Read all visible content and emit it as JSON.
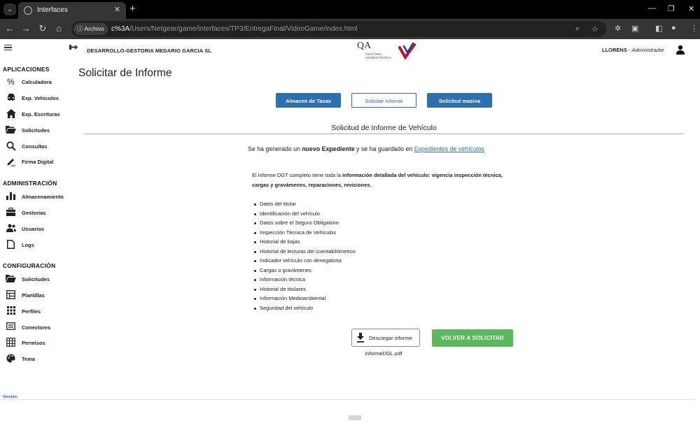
{
  "browser": {
    "tab_title": "Interfaces",
    "site_chip": "Archivo",
    "url_highlight": "c%3A",
    "url_rest": "/Users/Netgear/game/interfaces/TP3/EntregaFinal/VideoGame/index.html"
  },
  "header": {
    "company": "DESARROLLO-GESTORIA MEDARIO GARCIA SL",
    "logo_mark": "QA",
    "logo_text": "GESTORIA ADMINISTRATIVA",
    "user": "LLORENS",
    "role": "Administrador"
  },
  "sidebar": {
    "sections": {
      "aplicaciones": "APLICACIONES",
      "administracion": "ADMINISTRACIÓN",
      "configuracion": "CONFIGURACIÓN"
    },
    "aplicaciones": [
      {
        "label": "Calculadora",
        "icon": "percent-icon"
      },
      {
        "label": "Exp. Vehiculos",
        "icon": "car-icon"
      },
      {
        "label": "Exp. Escrituras",
        "icon": "home-icon"
      },
      {
        "label": "Solicitudes",
        "icon": "folder-open-icon"
      },
      {
        "label": "Consultas",
        "icon": "search-icon"
      },
      {
        "label": "Firma Digital",
        "icon": "signature-icon"
      }
    ],
    "administracion": [
      {
        "label": "Almacenamiento",
        "icon": "bar-chart-icon"
      },
      {
        "label": "Gestorias",
        "icon": "briefcase-icon"
      },
      {
        "label": "Usuarios",
        "icon": "users-icon"
      },
      {
        "label": "Logs",
        "icon": "document-icon"
      }
    ],
    "configuracion": [
      {
        "label": "Solicitudes",
        "icon": "folder-open-icon"
      },
      {
        "label": "Plantillas",
        "icon": "template-icon"
      },
      {
        "label": "Perfiles",
        "icon": "grid-icon"
      },
      {
        "label": "Conectores",
        "icon": "connector-icon"
      },
      {
        "label": "Permisos",
        "icon": "table-icon"
      },
      {
        "label": "Tema",
        "icon": "palette-icon"
      }
    ],
    "version_label": "Versión:"
  },
  "main": {
    "title": "Solicitar de Informe",
    "buttons": {
      "almacen": "Almacen de Tasas",
      "solicitar": "Solicitar Informe",
      "masiva": "Solicitud masiva"
    },
    "section_title": "Solicitud de Informe de Vehículo",
    "message": {
      "prefix": "Se ha generado un ",
      "bold": "nuevo Expediente",
      "middle": " y se ha guardado en ",
      "link": "Expedientes de vehículos"
    },
    "intro": {
      "prefix": "El informe DGT completo tiene toda la ",
      "bold": "información detallada del vehículo: vigencia inspección técnica, cargas y gravámenes, reparaciones, revisiones."
    },
    "features": [
      "Datos del titular",
      "Identificación del vehículo",
      "Datos sobre el Seguro Obligatorio",
      "Inspección Técnica de Vehículos",
      "Historial de bajas",
      "Historial de lecturas del cuentakilómetros",
      "Indicador vehículo con denegatoria",
      "Cargas o gravámenes",
      "Información técnica",
      "Historial de titulares",
      "Información Medioambiental",
      "Seguridad del vehículo"
    ],
    "download_label": "Descargar informe",
    "file_name": "informeDGL.pdf",
    "retry_label": "VOLVER A SOLICITAR"
  },
  "colors": {
    "primary": "#2d6faf",
    "success": "#5cb85c",
    "chrome_dark": "#353535"
  }
}
